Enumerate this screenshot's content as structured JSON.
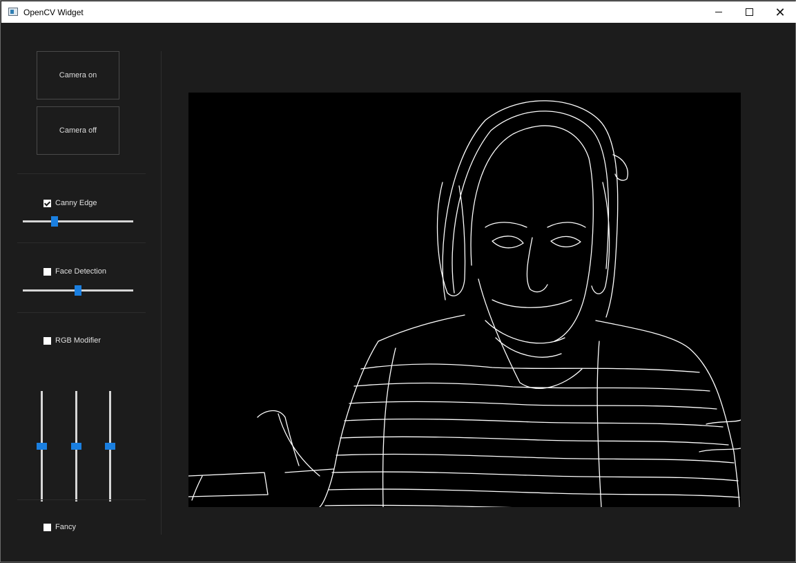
{
  "window": {
    "title": "OpenCV Widget",
    "controls": {
      "minimize": "minimize-icon",
      "maximize": "maximize-icon",
      "close": "close-icon"
    }
  },
  "buttons": {
    "camera_on": "Camera on",
    "camera_off": "Camera off"
  },
  "filters": {
    "canny_edge": {
      "label": "Canny Edge",
      "checked": true,
      "slider_fraction": 0.27
    },
    "face_detection": {
      "label": "Face Detection",
      "checked": false,
      "slider_fraction": 0.5
    },
    "rgb_modifier": {
      "label": "RGB Modifier",
      "checked": false,
      "sliders": [
        0.5,
        0.5,
        0.5
      ]
    },
    "fancy": {
      "label": "Fancy",
      "checked": false
    }
  },
  "video": {
    "content": "canny-edge-camera-feed",
    "background": "#000000",
    "edge_color": "#ffffff"
  },
  "colors": {
    "window_bg": "#1c1c1c",
    "accent": "#1a7fe0",
    "text": "#e0e0e0"
  }
}
